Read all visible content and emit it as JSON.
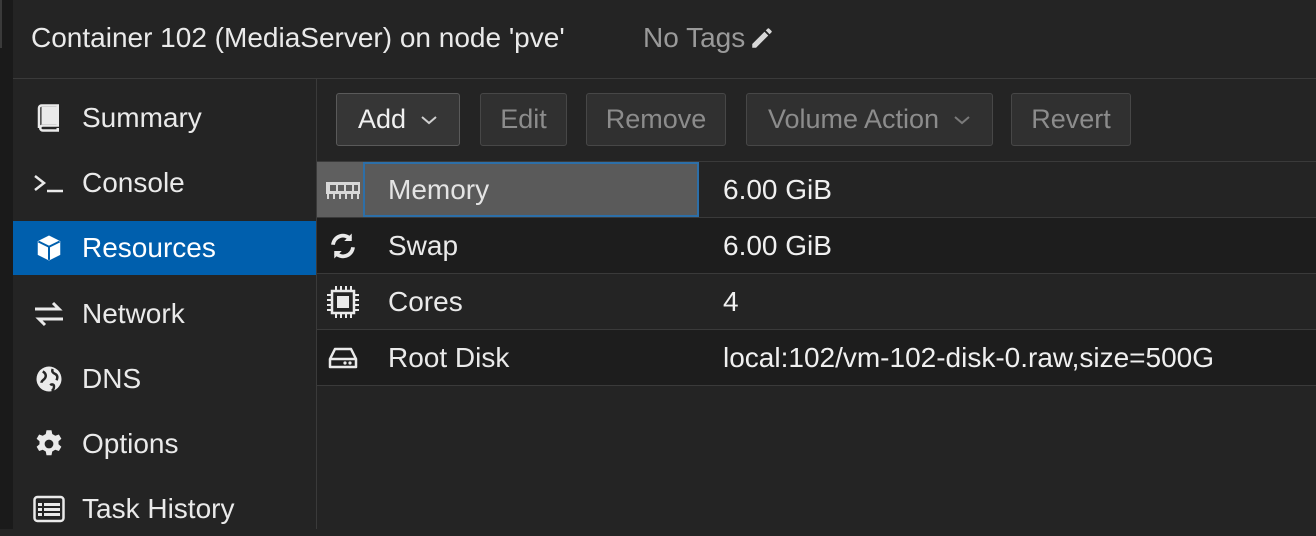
{
  "header": {
    "title": "Container 102 (MediaServer) on node 'pve'",
    "tags_label": "No Tags",
    "tags_icon": "pencil-icon"
  },
  "sidebar": {
    "items": [
      {
        "label": "Summary",
        "icon": "book-icon"
      },
      {
        "label": "Console",
        "icon": "terminal-icon"
      },
      {
        "label": "Resources",
        "icon": "cube-icon",
        "active": true
      },
      {
        "label": "Network",
        "icon": "exchange-icon"
      },
      {
        "label": "DNS",
        "icon": "globe-icon"
      },
      {
        "label": "Options",
        "icon": "gear-icon"
      },
      {
        "label": "Task History",
        "icon": "list-icon"
      }
    ]
  },
  "toolbar": {
    "add_label": "Add",
    "edit_label": "Edit",
    "remove_label": "Remove",
    "volume_action_label": "Volume Action",
    "revert_label": "Revert"
  },
  "resources": [
    {
      "name": "Memory",
      "value": "6.00 GiB",
      "icon": "memory-icon",
      "selected": true
    },
    {
      "name": "Swap",
      "value": "6.00 GiB",
      "icon": "refresh-icon"
    },
    {
      "name": "Cores",
      "value": "4",
      "icon": "cpu-icon"
    },
    {
      "name": "Root Disk",
      "value": "local:102/vm-102-disk-0.raw,size=500G",
      "icon": "hdd-icon"
    }
  ],
  "colors": {
    "accent": "#005fad",
    "background": "#242424",
    "row_alt": "#1d1d1d",
    "selected_row": "#5a5a5a"
  }
}
